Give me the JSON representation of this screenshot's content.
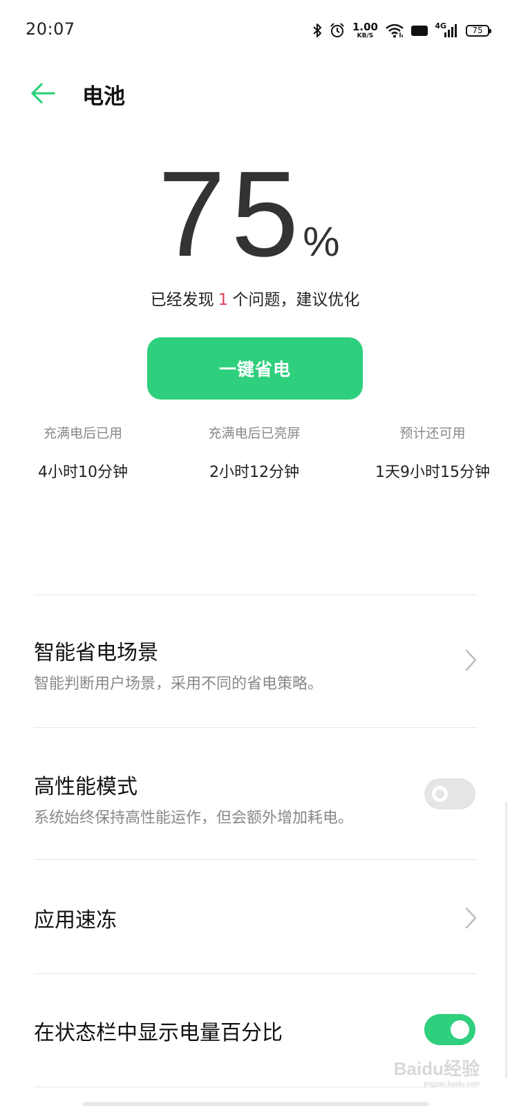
{
  "status_bar": {
    "time": "20:07",
    "net_speed_value": "1.00",
    "net_speed_unit": "KB/S",
    "hd_badge": "HD",
    "network_type": "4G",
    "battery_level": "75",
    "icons": [
      "bluetooth-icon",
      "alarm-icon",
      "wifi-icon",
      "hd-icon",
      "signal-icon",
      "battery-icon"
    ]
  },
  "header": {
    "title": "电池",
    "back_icon": "arrow-left-icon"
  },
  "battery": {
    "percent": "75",
    "percent_sign": "%",
    "issue_prefix": "已经发现",
    "issue_count": "1",
    "issue_suffix": "个问题，建议优化"
  },
  "save_button": {
    "label": "一键省电"
  },
  "stats": [
    {
      "label": "充满电后已用",
      "value": "4小时10分钟"
    },
    {
      "label": "充满电后已亮屏",
      "value": "2小时12分钟"
    },
    {
      "label": "预计还可用",
      "value": "1天9小时15分钟"
    }
  ],
  "settings": [
    {
      "title": "智能省电场景",
      "subtitle": "智能判断用户场景，采用不同的省电策略。",
      "control": "chevron"
    },
    {
      "title": "高性能模式",
      "subtitle": "系统始终保持高性能运作，但会额外增加耗电。",
      "control": "toggle",
      "enabled": false
    },
    {
      "title": "应用速冻",
      "control": "chevron"
    },
    {
      "title": "在状态栏中显示电量百分比",
      "control": "toggle",
      "enabled": true
    }
  ],
  "watermark": {
    "text": "Baidu经验",
    "sub": "jingyan.baidu.com"
  },
  "colors": {
    "accent": "#2ecf7d",
    "issue_count": "#e0445c",
    "text_primary": "#222222",
    "text_secondary": "#888888",
    "divider": "#e6e6e6"
  }
}
